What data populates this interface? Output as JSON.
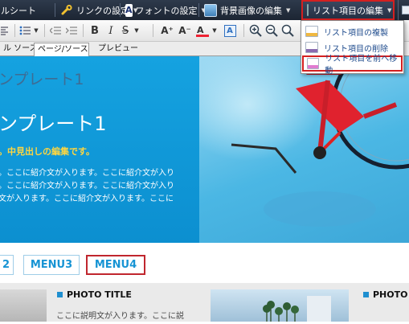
{
  "toolbar_top": {
    "rich_label": "ルシート",
    "link_label": "リンクの設定",
    "font_label": "フォントの設定",
    "bg_label": "背景画像の編集",
    "list_label": "リスト項目の編集",
    "dropdown_glyph": "▼"
  },
  "toolbar_format": {
    "bold": "B",
    "italic": "I",
    "strike": "S",
    "font_grow": "A⁺",
    "font_shrink": "A⁻"
  },
  "tabs": {
    "source": "ル ソース",
    "page_source": "ページ/ソース",
    "preview": "プレビュー"
  },
  "dropdown_menu": {
    "items": [
      "リスト項目の複製",
      "リスト項目の削除",
      "リスト項目を前へ移動"
    ]
  },
  "hero": {
    "small_title": "ンプレート1",
    "big_title": "ンプレート1",
    "subtitle": "。中見出しの編集です。",
    "lines": [
      "。ここに紹介文が入ります。ここに紹介文が入り",
      "。ここに紹介文が入ります。ここに紹介文が入り",
      "文が入ります。ここに紹介文が入ります。ここに"
    ]
  },
  "menu": [
    "2",
    "MENU3",
    "MENU4"
  ],
  "cards": [
    {
      "title": "PHOTO TITLE",
      "desc": "ここに説明文が入ります。ここに説"
    },
    {
      "title": "PHOTO"
    }
  ],
  "colors": {
    "toolbar_bg": "#253044",
    "highlight_red": "#d42020",
    "hero_blue": "#12a0df",
    "menu_blue": "#1794d4",
    "subtitle_yellow": "#ffd640"
  }
}
